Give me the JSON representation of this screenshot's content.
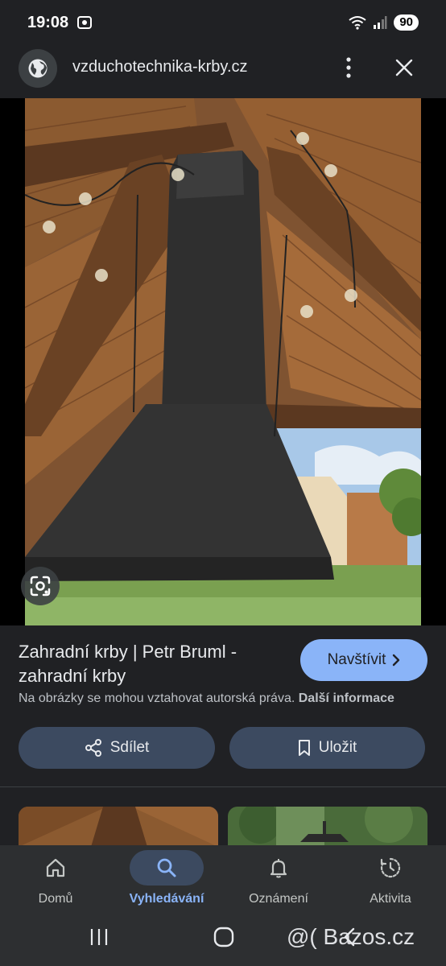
{
  "status_bar": {
    "time": "19:08",
    "battery": "90"
  },
  "url_bar": {
    "domain": "vzduchotechnika-krby.cz",
    "globe_icon": "globe-icon",
    "menu_icon": "more-vert-icon",
    "close_icon": "close-icon"
  },
  "result": {
    "title": "Zahradní krby | Petr Bruml - zahradní krby",
    "visit_label": "Navštívit",
    "copyright_text": "Na obrázky se mohou vztahovat autorská práva.",
    "more_info_label": "Další informace",
    "share_label": "Sdílet",
    "save_label": "Uložit"
  },
  "bottom_nav": {
    "items": [
      {
        "label": "Domů",
        "icon": "home-icon"
      },
      {
        "label": "Vyhledávání",
        "icon": "search-icon",
        "active": true
      },
      {
        "label": "Oznámení",
        "icon": "bell-icon"
      },
      {
        "label": "Aktivita",
        "icon": "activity-icon"
      }
    ]
  },
  "watermark": "@( Bazos.cz",
  "colors": {
    "background": "#202124",
    "accent": "#8ab4f8",
    "tonal_button": "#3c4a60",
    "nav_background": "#2d2f31"
  }
}
